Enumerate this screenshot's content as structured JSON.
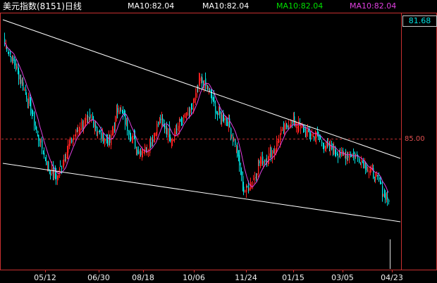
{
  "header": {
    "title": "美元指数(8151)日线",
    "ma": [
      {
        "label": "MA10:82.04",
        "color": "#ffffff"
      },
      {
        "label": "MA10:82.04",
        "color": "#ffffff"
      },
      {
        "label": "MA10:82.04",
        "color": "#00e000"
      },
      {
        "label": "MA10:82.04",
        "color": "#e040e0"
      }
    ]
  },
  "price_axis": {
    "current_value": "81.68",
    "reference_label": "85.00"
  },
  "date_axis": [
    "05/12",
    "06/30",
    "08/18",
    "10/06",
    "11/24",
    "01/15",
    "03/05",
    "04/23"
  ],
  "colors": {
    "up": "#ff2020",
    "down": "#00e0e0",
    "ma": "#e040e0",
    "trendline": "#ffffff",
    "reference": "#c03030",
    "frame": "#c83030"
  },
  "chart_data": {
    "type": "candlestick",
    "x_ticks": [
      "05/12",
      "06/30",
      "08/18",
      "10/06",
      "11/24",
      "01/15",
      "03/05",
      "04/23"
    ],
    "reference_price": 85.0,
    "last_value": 81.68,
    "anchors": [
      [
        0,
        90.2
      ],
      [
        12,
        88.6
      ],
      [
        22,
        87.0
      ],
      [
        30,
        85.2
      ],
      [
        40,
        83.4
      ],
      [
        48,
        82.9
      ],
      [
        58,
        84.6
      ],
      [
        70,
        85.8
      ],
      [
        80,
        86.0
      ],
      [
        88,
        85.1
      ],
      [
        96,
        84.8
      ],
      [
        104,
        86.8
      ],
      [
        112,
        85.6
      ],
      [
        122,
        84.3
      ],
      [
        132,
        84.6
      ],
      [
        142,
        86.1
      ],
      [
        152,
        85.0
      ],
      [
        160,
        85.9
      ],
      [
        170,
        86.4
      ],
      [
        178,
        88.2
      ],
      [
        186,
        87.6
      ],
      [
        194,
        86.3
      ],
      [
        202,
        86.1
      ],
      [
        210,
        84.8
      ],
      [
        218,
        82.2
      ],
      [
        226,
        82.7
      ],
      [
        232,
        83.7
      ],
      [
        240,
        84.0
      ],
      [
        246,
        84.5
      ],
      [
        252,
        85.3
      ],
      [
        260,
        85.9
      ],
      [
        268,
        85.7
      ],
      [
        276,
        85.3
      ],
      [
        284,
        85.2
      ],
      [
        292,
        84.6
      ],
      [
        300,
        84.4
      ],
      [
        308,
        84.1
      ],
      [
        316,
        84.2
      ],
      [
        324,
        83.9
      ],
      [
        332,
        83.3
      ],
      [
        340,
        82.8
      ],
      [
        344,
        82.2
      ],
      [
        350,
        81.7
      ]
    ]
  }
}
